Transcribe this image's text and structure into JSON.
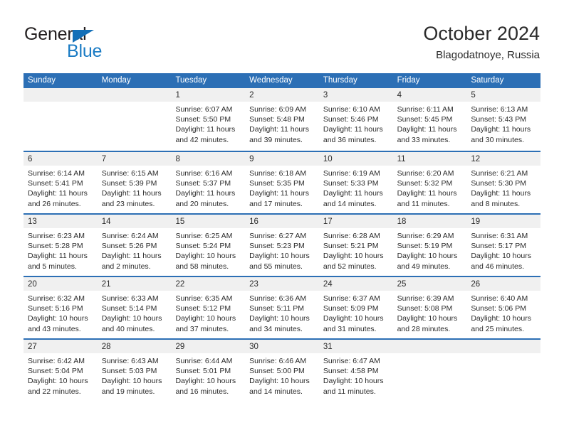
{
  "logo": {
    "primary_text": "General",
    "secondary_text": "Blue",
    "primary_color": "#231f20",
    "secondary_color": "#1a7bc4",
    "triangle_color": "#1470b8"
  },
  "header": {
    "title": "October 2024",
    "location": "Blagodatnoye, Russia"
  },
  "theme": {
    "header_blue": "#2c6fb5",
    "day_band_gray": "#f0f0f0",
    "text_color": "#2b2b2b"
  },
  "weekdays": [
    "Sunday",
    "Monday",
    "Tuesday",
    "Wednesday",
    "Thursday",
    "Friday",
    "Saturday"
  ],
  "weeks": [
    [
      {
        "day": "",
        "lines": []
      },
      {
        "day": "",
        "lines": []
      },
      {
        "day": "1",
        "lines": [
          "Sunrise: 6:07 AM",
          "Sunset: 5:50 PM",
          "Daylight: 11 hours",
          "and 42 minutes."
        ]
      },
      {
        "day": "2",
        "lines": [
          "Sunrise: 6:09 AM",
          "Sunset: 5:48 PM",
          "Daylight: 11 hours",
          "and 39 minutes."
        ]
      },
      {
        "day": "3",
        "lines": [
          "Sunrise: 6:10 AM",
          "Sunset: 5:46 PM",
          "Daylight: 11 hours",
          "and 36 minutes."
        ]
      },
      {
        "day": "4",
        "lines": [
          "Sunrise: 6:11 AM",
          "Sunset: 5:45 PM",
          "Daylight: 11 hours",
          "and 33 minutes."
        ]
      },
      {
        "day": "5",
        "lines": [
          "Sunrise: 6:13 AM",
          "Sunset: 5:43 PM",
          "Daylight: 11 hours",
          "and 30 minutes."
        ]
      }
    ],
    [
      {
        "day": "6",
        "lines": [
          "Sunrise: 6:14 AM",
          "Sunset: 5:41 PM",
          "Daylight: 11 hours",
          "and 26 minutes."
        ]
      },
      {
        "day": "7",
        "lines": [
          "Sunrise: 6:15 AM",
          "Sunset: 5:39 PM",
          "Daylight: 11 hours",
          "and 23 minutes."
        ]
      },
      {
        "day": "8",
        "lines": [
          "Sunrise: 6:16 AM",
          "Sunset: 5:37 PM",
          "Daylight: 11 hours",
          "and 20 minutes."
        ]
      },
      {
        "day": "9",
        "lines": [
          "Sunrise: 6:18 AM",
          "Sunset: 5:35 PM",
          "Daylight: 11 hours",
          "and 17 minutes."
        ]
      },
      {
        "day": "10",
        "lines": [
          "Sunrise: 6:19 AM",
          "Sunset: 5:33 PM",
          "Daylight: 11 hours",
          "and 14 minutes."
        ]
      },
      {
        "day": "11",
        "lines": [
          "Sunrise: 6:20 AM",
          "Sunset: 5:32 PM",
          "Daylight: 11 hours",
          "and 11 minutes."
        ]
      },
      {
        "day": "12",
        "lines": [
          "Sunrise: 6:21 AM",
          "Sunset: 5:30 PM",
          "Daylight: 11 hours",
          "and 8 minutes."
        ]
      }
    ],
    [
      {
        "day": "13",
        "lines": [
          "Sunrise: 6:23 AM",
          "Sunset: 5:28 PM",
          "Daylight: 11 hours",
          "and 5 minutes."
        ]
      },
      {
        "day": "14",
        "lines": [
          "Sunrise: 6:24 AM",
          "Sunset: 5:26 PM",
          "Daylight: 11 hours",
          "and 2 minutes."
        ]
      },
      {
        "day": "15",
        "lines": [
          "Sunrise: 6:25 AM",
          "Sunset: 5:24 PM",
          "Daylight: 10 hours",
          "and 58 minutes."
        ]
      },
      {
        "day": "16",
        "lines": [
          "Sunrise: 6:27 AM",
          "Sunset: 5:23 PM",
          "Daylight: 10 hours",
          "and 55 minutes."
        ]
      },
      {
        "day": "17",
        "lines": [
          "Sunrise: 6:28 AM",
          "Sunset: 5:21 PM",
          "Daylight: 10 hours",
          "and 52 minutes."
        ]
      },
      {
        "day": "18",
        "lines": [
          "Sunrise: 6:29 AM",
          "Sunset: 5:19 PM",
          "Daylight: 10 hours",
          "and 49 minutes."
        ]
      },
      {
        "day": "19",
        "lines": [
          "Sunrise: 6:31 AM",
          "Sunset: 5:17 PM",
          "Daylight: 10 hours",
          "and 46 minutes."
        ]
      }
    ],
    [
      {
        "day": "20",
        "lines": [
          "Sunrise: 6:32 AM",
          "Sunset: 5:16 PM",
          "Daylight: 10 hours",
          "and 43 minutes."
        ]
      },
      {
        "day": "21",
        "lines": [
          "Sunrise: 6:33 AM",
          "Sunset: 5:14 PM",
          "Daylight: 10 hours",
          "and 40 minutes."
        ]
      },
      {
        "day": "22",
        "lines": [
          "Sunrise: 6:35 AM",
          "Sunset: 5:12 PM",
          "Daylight: 10 hours",
          "and 37 minutes."
        ]
      },
      {
        "day": "23",
        "lines": [
          "Sunrise: 6:36 AM",
          "Sunset: 5:11 PM",
          "Daylight: 10 hours",
          "and 34 minutes."
        ]
      },
      {
        "day": "24",
        "lines": [
          "Sunrise: 6:37 AM",
          "Sunset: 5:09 PM",
          "Daylight: 10 hours",
          "and 31 minutes."
        ]
      },
      {
        "day": "25",
        "lines": [
          "Sunrise: 6:39 AM",
          "Sunset: 5:08 PM",
          "Daylight: 10 hours",
          "and 28 minutes."
        ]
      },
      {
        "day": "26",
        "lines": [
          "Sunrise: 6:40 AM",
          "Sunset: 5:06 PM",
          "Daylight: 10 hours",
          "and 25 minutes."
        ]
      }
    ],
    [
      {
        "day": "27",
        "lines": [
          "Sunrise: 6:42 AM",
          "Sunset: 5:04 PM",
          "Daylight: 10 hours",
          "and 22 minutes."
        ]
      },
      {
        "day": "28",
        "lines": [
          "Sunrise: 6:43 AM",
          "Sunset: 5:03 PM",
          "Daylight: 10 hours",
          "and 19 minutes."
        ]
      },
      {
        "day": "29",
        "lines": [
          "Sunrise: 6:44 AM",
          "Sunset: 5:01 PM",
          "Daylight: 10 hours",
          "and 16 minutes."
        ]
      },
      {
        "day": "30",
        "lines": [
          "Sunrise: 6:46 AM",
          "Sunset: 5:00 PM",
          "Daylight: 10 hours",
          "and 14 minutes."
        ]
      },
      {
        "day": "31",
        "lines": [
          "Sunrise: 6:47 AM",
          "Sunset: 4:58 PM",
          "Daylight: 10 hours",
          "and 11 minutes."
        ]
      },
      {
        "day": "",
        "lines": []
      },
      {
        "day": "",
        "lines": []
      }
    ]
  ]
}
